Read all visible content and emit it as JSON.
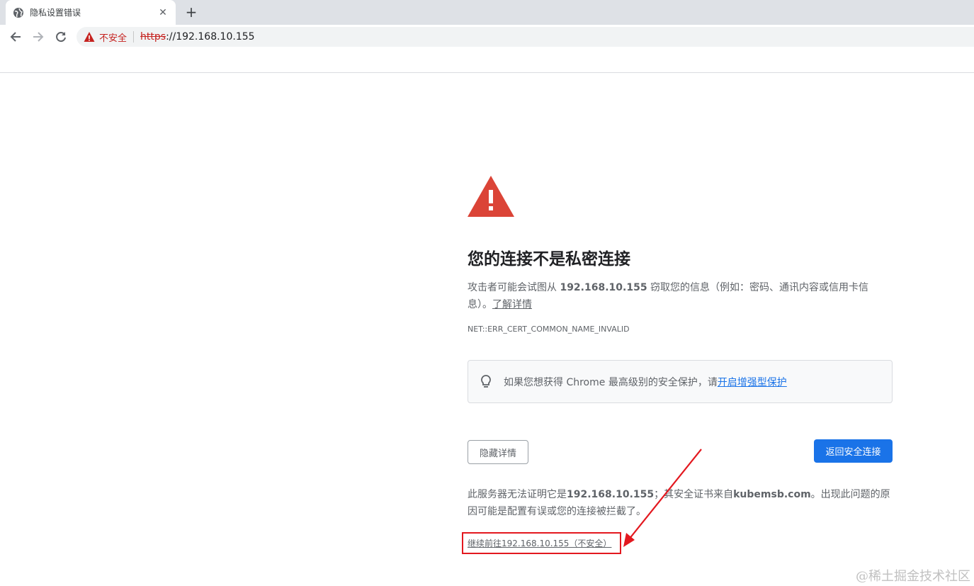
{
  "tab": {
    "title": "隐私设置错误",
    "close": "✕",
    "new_tab": "+"
  },
  "omnibox": {
    "security_label": "不安全",
    "scheme": "https",
    "rest": "://192.168.10.155"
  },
  "page": {
    "heading": "您的连接不是私密连接",
    "desc_prefix": "攻击者可能会试图从 ",
    "desc_host": "192.168.10.155",
    "desc_suffix": " 窃取您的信息（例如：密码、通讯内容或信用卡信息）。",
    "learn_more": "了解详情",
    "error_code": "NET::ERR_CERT_COMMON_NAME_INVALID",
    "enhanced_text": "如果您想获得 Chrome 最高级别的安全保护，请",
    "enhanced_link": "开启增强型保护",
    "hide_details": "隐藏详情",
    "back_to_safety": "返回安全连接",
    "foot_1": "此服务器无法证明它是",
    "foot_host": "192.168.10.155",
    "foot_2": "；其安全证书来自",
    "foot_domain": "kubemsb.com",
    "foot_3": "。出现此问题的原因可能是配置有误或您的连接被拦截了。",
    "proceed_link": "继续前往192.168.10.155（不安全）"
  },
  "watermark": "@稀土掘金技术社区",
  "colors": {
    "danger": "#db4437",
    "accent": "#1a73e8",
    "annotation": "#e3181f"
  },
  "icons": [
    "globe-icon",
    "close-icon",
    "plus-icon",
    "back-arrow-icon",
    "forward-arrow-icon",
    "reload-icon",
    "warning-icon",
    "lightbulb-icon"
  ]
}
